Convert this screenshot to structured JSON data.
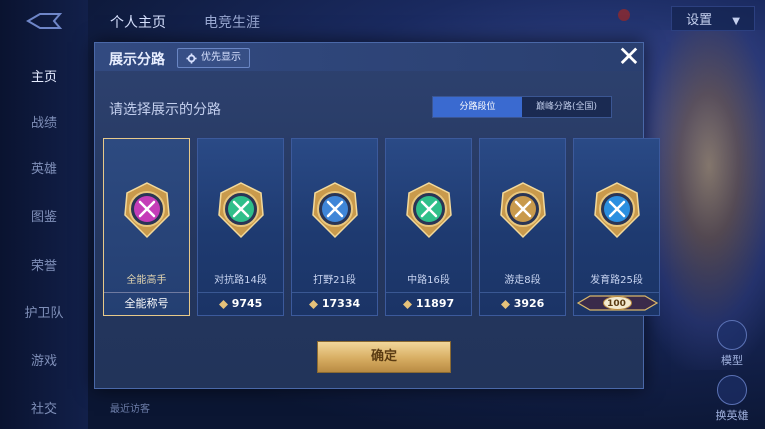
{
  "top_tabs": [
    "个人主页",
    "电竞生涯"
  ],
  "settings_label": "设置",
  "sidebar": [
    "主页",
    "战绩",
    "英雄",
    "图鉴",
    "荣誉",
    "护卫队",
    "游戏",
    "社交"
  ],
  "right_buttons": [
    "模型",
    "换英雄"
  ],
  "recent_label": "最近访客",
  "dialog": {
    "title": "展示分路",
    "priority_label": "优先显示",
    "subtitle": "请选择展示的分路",
    "segments": [
      "分路段位",
      "巅峰分路(全国)"
    ],
    "active_segment": 0,
    "confirm_label": "确定",
    "cards": [
      {
        "label": "全能高手",
        "footer": "全能称号",
        "selected": true,
        "badge_color": "#c53db8",
        "icon": "crossed-square-icon"
      },
      {
        "label": "对抗路14段",
        "footer": "9745",
        "selected": false,
        "badge_color": "#2fbf8a",
        "icon": "sword-icon"
      },
      {
        "label": "打野21段",
        "footer": "17334",
        "selected": false,
        "badge_color": "#3f86d8",
        "icon": "dragon-icon"
      },
      {
        "label": "中路16段",
        "footer": "11897",
        "selected": false,
        "badge_color": "#2fbf8a",
        "icon": "staff-icon"
      },
      {
        "label": "游走8段",
        "footer": "3926",
        "selected": false,
        "badge_color": "#c99a4c",
        "icon": "wings-icon"
      },
      {
        "label": "发育路25段",
        "footer": "",
        "badge_number": "100",
        "selected": false,
        "badge_color": "#2b8fe0",
        "icon": "target-icon"
      }
    ]
  }
}
